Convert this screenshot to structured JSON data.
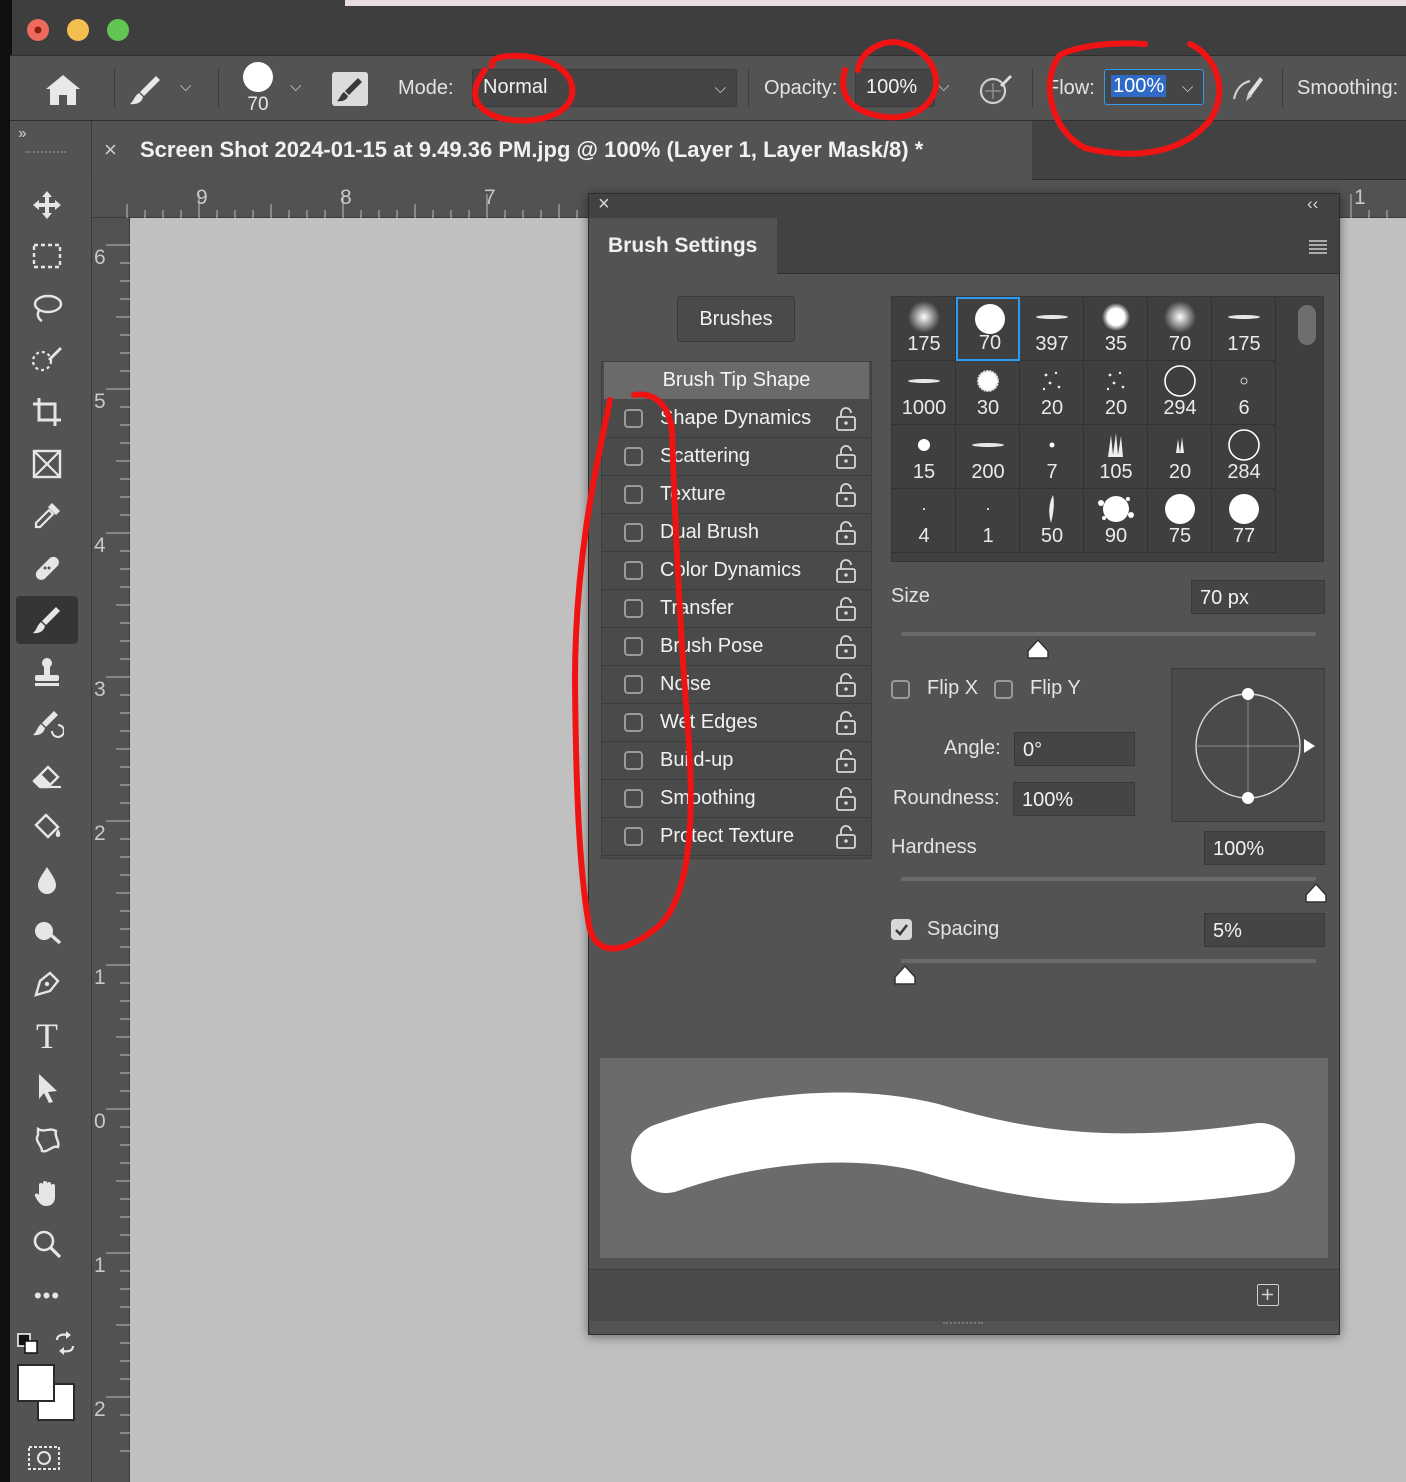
{
  "window": {
    "traffic_lights": [
      "close",
      "minimize",
      "zoom"
    ],
    "colors": {
      "close": "#ed6a5e",
      "minimize": "#f5bf4f",
      "zoom": "#61c554"
    }
  },
  "options_bar": {
    "brush_size": "70",
    "mode_label": "Mode:",
    "mode_value": "Normal",
    "opacity_label": "Opacity:",
    "opacity_value": "100%",
    "flow_label": "Flow:",
    "flow_value": "100%",
    "smoothing_label": "Smoothing:"
  },
  "document_tab": {
    "close": "×",
    "title": "Screen Shot 2024-01-15 at 9.49.36 PM.jpg @ 100% (Layer 1, Layer Mask/8) *"
  },
  "rulers": {
    "horizontal": [
      "9",
      "8",
      "7",
      "1"
    ],
    "vertical": [
      "6",
      "5",
      "4",
      "3",
      "2",
      "1",
      "0",
      "1",
      "2"
    ]
  },
  "toolbar": {
    "collapse": "››",
    "tools": [
      "move-tool",
      "marquee-tool",
      "lasso-tool",
      "quick-selection-tool",
      "crop-tool",
      "frame-tool",
      "eyedropper-tool",
      "healing-brush-tool",
      "brush-tool",
      "clone-stamp-tool",
      "history-brush-tool",
      "eraser-tool",
      "paint-bucket-tool",
      "blur-tool",
      "dodge-tool",
      "pen-tool",
      "type-tool",
      "path-selection-tool",
      "shape-tool",
      "hand-tool",
      "zoom-tool",
      "more-tools"
    ],
    "active_tool": "brush-tool",
    "type_glyph": "T",
    "more_glyph": "•••"
  },
  "brush_settings": {
    "close": "×",
    "collapse": "‹‹",
    "title": "Brush Settings",
    "brushes_button": "Brushes",
    "options": [
      {
        "label": "Brush Tip Shape",
        "header": true
      },
      {
        "label": "Shape Dynamics",
        "checked": false
      },
      {
        "label": "Scattering",
        "checked": false
      },
      {
        "label": "Texture",
        "checked": false
      },
      {
        "label": "Dual Brush",
        "checked": false
      },
      {
        "label": "Color Dynamics",
        "checked": false
      },
      {
        "label": "Transfer",
        "checked": false
      },
      {
        "label": "Brush Pose",
        "checked": false
      },
      {
        "label": "Noise",
        "checked": false
      },
      {
        "label": "Wet Edges",
        "checked": false
      },
      {
        "label": "Build-up",
        "checked": false
      },
      {
        "label": "Smoothing",
        "checked": false
      },
      {
        "label": "Protect Texture",
        "checked": false
      }
    ],
    "presets": [
      {
        "size": "175",
        "kind": "soft"
      },
      {
        "size": "70",
        "kind": "hard",
        "selected": true
      },
      {
        "size": "397",
        "kind": "stroke"
      },
      {
        "size": "35",
        "kind": "soft-small"
      },
      {
        "size": "70",
        "kind": "soft"
      },
      {
        "size": "175",
        "kind": "stroke"
      },
      {
        "size": "1000",
        "kind": "stroke"
      },
      {
        "size": "30",
        "kind": "rough"
      },
      {
        "size": "20",
        "kind": "dots"
      },
      {
        "size": "20",
        "kind": "dots"
      },
      {
        "size": "294",
        "kind": "ring"
      },
      {
        "size": "6",
        "kind": "tiny-ring"
      },
      {
        "size": "15",
        "kind": "dot"
      },
      {
        "size": "200",
        "kind": "stroke"
      },
      {
        "size": "7",
        "kind": "small-dot"
      },
      {
        "size": "105",
        "kind": "grass"
      },
      {
        "size": "20",
        "kind": "grass-small"
      },
      {
        "size": "284",
        "kind": "ring"
      },
      {
        "size": "4",
        "kind": "pixel"
      },
      {
        "size": "1",
        "kind": "pixel"
      },
      {
        "size": "50",
        "kind": "leaf"
      },
      {
        "size": "90",
        "kind": "splatter"
      },
      {
        "size": "75",
        "kind": "hard"
      },
      {
        "size": "77",
        "kind": "hard"
      }
    ],
    "size_label": "Size",
    "size_value": "70 px",
    "size_slider": 0.33,
    "flip_x_label": "Flip X",
    "flip_y_label": "Flip Y",
    "angle_label": "Angle:",
    "angle_value": "0°",
    "roundness_label": "Roundness:",
    "roundness_value": "100%",
    "hardness_label": "Hardness",
    "hardness_value": "100%",
    "hardness_slider": 1.0,
    "spacing_label": "Spacing",
    "spacing_checked": true,
    "spacing_value": "5%",
    "spacing_slider": 0.01
  }
}
